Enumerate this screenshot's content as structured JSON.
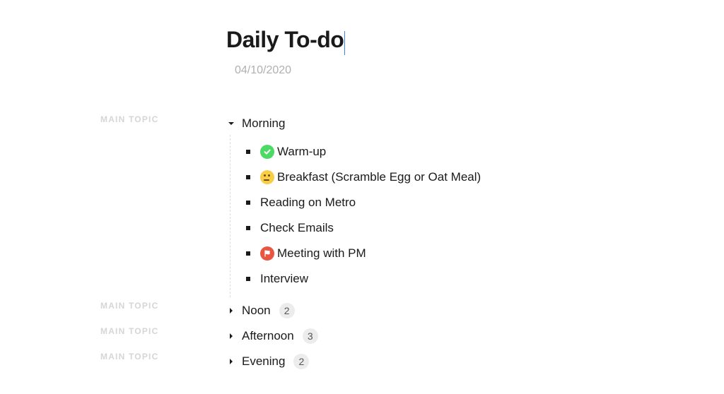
{
  "title": "Daily To-do",
  "date": "04/10/2020",
  "sideLabel": "MAIN TOPIC",
  "topics": [
    {
      "name": "Morning",
      "expanded": true,
      "items": [
        {
          "icon": "check",
          "text": "Warm-up"
        },
        {
          "icon": "think",
          "text": "Breakfast (Scramble Egg or Oat Meal)"
        },
        {
          "icon": null,
          "text": "Reading on Metro"
        },
        {
          "icon": null,
          "text": "Check Emails"
        },
        {
          "icon": "flag",
          "text": "Meeting with PM"
        },
        {
          "icon": null,
          "text": "Interview"
        }
      ]
    },
    {
      "name": "Noon",
      "expanded": false,
      "count": 2
    },
    {
      "name": "Afternoon",
      "expanded": false,
      "count": 3
    },
    {
      "name": "Evening",
      "expanded": false,
      "count": 2
    }
  ]
}
